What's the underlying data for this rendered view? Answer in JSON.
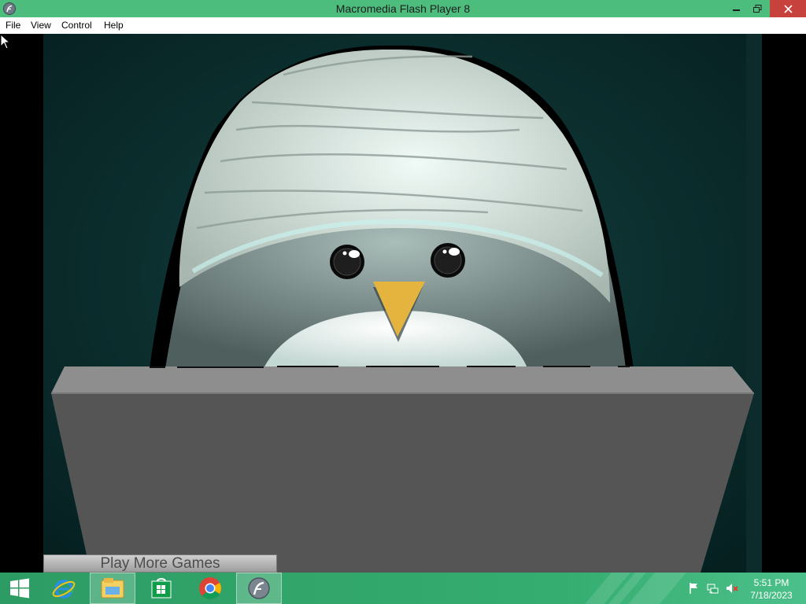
{
  "window": {
    "title": "Macromedia Flash Player 8",
    "controls": {
      "minimize": "minimize-icon",
      "maximize": "restore-icon",
      "close": "close-icon"
    },
    "accent": "#4dbd7e"
  },
  "menu": [
    "File",
    "View",
    "Control",
    "Help"
  ],
  "game": {
    "play_more_label": "Play More Games",
    "colors": {
      "background": "#0b2a2a",
      "bandage": "#d8e6e0",
      "body": "#708482",
      "belly": "#dfeeea",
      "beak": "#e4b43f",
      "desk": "#555555",
      "desk_top": "#8a8a8a"
    }
  },
  "taskbar": {
    "apps": [
      {
        "name": "start-icon",
        "active": false
      },
      {
        "name": "internet-explorer-icon",
        "active": false
      },
      {
        "name": "file-explorer-icon",
        "active": false
      },
      {
        "name": "store-icon",
        "active": false
      },
      {
        "name": "chrome-icon",
        "active": false
      },
      {
        "name": "flash-player-icon",
        "active": true
      }
    ],
    "tray_icons": [
      "action-center-flag-icon",
      "network-icon",
      "volume-muted-icon"
    ],
    "clock": {
      "time": "5:51 PM",
      "date": "7/18/2023"
    }
  }
}
